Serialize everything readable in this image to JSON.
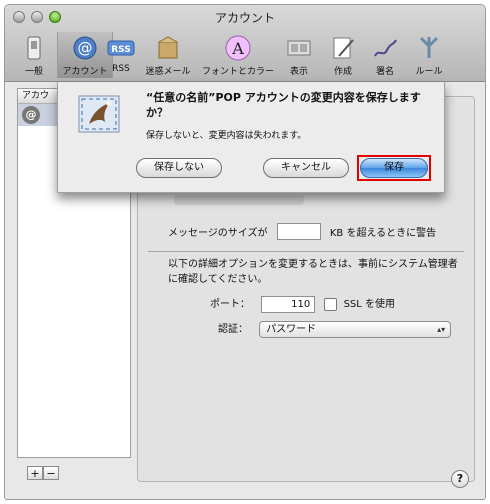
{
  "window": {
    "title": "アカウント"
  },
  "toolbar": {
    "items": [
      {
        "label": "一般",
        "icon": "switch-icon"
      },
      {
        "label": "アカウント",
        "icon": "at-sign-icon",
        "selected": true
      },
      {
        "label": "RSS",
        "icon": "rss-icon"
      },
      {
        "label": "迷惑メール",
        "icon": "junk-mail-icon"
      },
      {
        "label": "フォントとカラー",
        "icon": "font-color-icon"
      },
      {
        "label": "表示",
        "icon": "display-icon"
      },
      {
        "label": "作成",
        "icon": "compose-icon"
      },
      {
        "label": "署名",
        "icon": "signature-icon"
      },
      {
        "label": "ルール",
        "icon": "rules-icon"
      }
    ],
    "rss_badge": "RSS",
    "font_badge": "A"
  },
  "sidebar": {
    "header": "アカウ",
    "account_icon_glyph": "@"
  },
  "pane": {
    "message_size_label": "メッセージのサイズが",
    "message_size_value": "",
    "message_size_suffix": "KB を超えるときに警告",
    "advanced_note": "以下の詳細オプションを変更するときは、事前にシステム管理者に確認してください。",
    "port_label": "ポート：",
    "port_value": "110",
    "ssl_label": "SSL を使用",
    "auth_label": "認証：",
    "auth_value": "パスワード"
  },
  "footer": {
    "add_label": "+",
    "remove_label": "−",
    "help_label": "?"
  },
  "dialog": {
    "title": "“任意の名前”POP アカウントの変更内容を保存しますか？",
    "message": "保存しないと、変更内容は失われます。",
    "dont_save_label": "保存しない",
    "cancel_label": "キャンセル",
    "save_label": "保存",
    "highlight_color": "#e00000"
  }
}
